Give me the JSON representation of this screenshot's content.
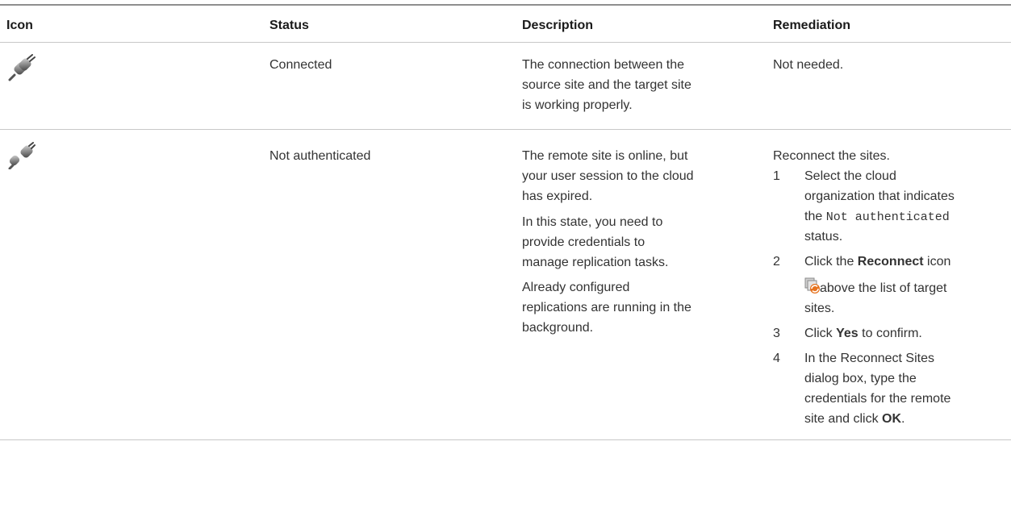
{
  "headers": {
    "icon": "Icon",
    "status": "Status",
    "description": "Description",
    "remediation": "Remediation"
  },
  "rows": [
    {
      "icon": "plug-connected-icon",
      "status": "Connected",
      "description_lines": [
        "The connection between the",
        "source site and the target site",
        "is working properly."
      ],
      "remediation": "Not needed."
    },
    {
      "icon": "plug-disconnected-icon",
      "status": "Not authenticated",
      "description_lines": [
        "The remote site is online, but",
        "your user session to the cloud",
        "has expired.",
        "In this state, you need to",
        "provide credentials to",
        "manage replication tasks.",
        "Already configured",
        "replications are running in the",
        "background."
      ],
      "remediation_intro": "Reconnect the sites.",
      "steps": {
        "n1": "1",
        "s1_l1": "Select the cloud",
        "s1_l2": "organization that indicates",
        "s1_l3_pre": "the ",
        "s1_l3_code": "Not authenticated",
        "s1_l4": "status.",
        "n2": "2",
        "s2_l1_pre": "Click the ",
        "s2_l1_bold": "Reconnect",
        "s2_l1_post": " icon",
        "s2_l2": " above the list of target",
        "s2_l3": "sites.",
        "n3": "3",
        "s3_pre": "Click ",
        "s3_bold": "Yes",
        "s3_post": " to confirm.",
        "n4": "4",
        "s4_l1": "In the Reconnect Sites",
        "s4_l2": "dialog box, type the",
        "s4_l3": "credentials for the remote",
        "s4_l4_pre": "site and click ",
        "s4_l4_bold": "OK",
        "s4_l4_post": "."
      }
    }
  ]
}
